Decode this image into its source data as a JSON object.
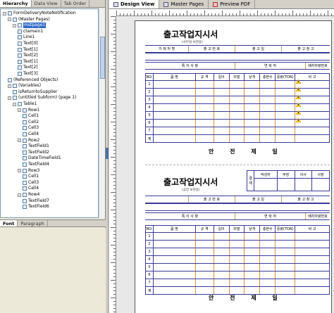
{
  "left_panel": {
    "tabs": [
      "Hierarchy",
      "Data View",
      "Tab Order"
    ],
    "tree": [
      {
        "label": "FormDeliveryNoteNotification",
        "indent": 0,
        "expander": "-"
      },
      {
        "label": "(Master Pages)",
        "indent": 1,
        "expander": "-"
      },
      {
        "label": "mstpage1",
        "indent": 2,
        "expander": "-",
        "selected": true
      },
      {
        "label": "ctamain1",
        "indent": 3
      },
      {
        "label": "Line1",
        "indent": 3
      },
      {
        "label": "Text[0]",
        "indent": 3
      },
      {
        "label": "Text[1]",
        "indent": 3
      },
      {
        "label": "Text[2]",
        "indent": 3
      },
      {
        "label": "Text[1]",
        "indent": 3
      },
      {
        "label": "Text[2]",
        "indent": 3
      },
      {
        "label": "Text[3]",
        "indent": 3
      },
      {
        "label": "(Referenced Objects)",
        "indent": 1
      },
      {
        "label": "(Variables)",
        "indent": 1,
        "expander": "-"
      },
      {
        "label": "isReturntoSupplier",
        "indent": 2
      },
      {
        "label": "(untitled Subform) (page 1)",
        "indent": 1,
        "expander": "-"
      },
      {
        "label": "Table1",
        "indent": 2,
        "expander": "-"
      },
      {
        "label": "Row1",
        "indent": 3,
        "expander": "-"
      },
      {
        "label": "Cell1",
        "indent": 4
      },
      {
        "label": "Cell2",
        "indent": 4
      },
      {
        "label": "Cell3",
        "indent": 4
      },
      {
        "label": "Cell4",
        "indent": 4
      },
      {
        "label": "Row2",
        "indent": 3,
        "expander": "-"
      },
      {
        "label": "TextField1",
        "indent": 4
      },
      {
        "label": "TextField2",
        "indent": 4
      },
      {
        "label": "DateTimeField1",
        "indent": 4
      },
      {
        "label": "TextField4",
        "indent": 4
      },
      {
        "label": "Row3",
        "indent": 3,
        "expander": "-"
      },
      {
        "label": "Cell1",
        "indent": 4
      },
      {
        "label": "Cell3",
        "indent": 4
      },
      {
        "label": "Cell4",
        "indent": 4
      },
      {
        "label": "Row4",
        "indent": 3,
        "expander": "-"
      },
      {
        "label": "TextField7",
        "indent": 4
      },
      {
        "label": "TextField6",
        "indent": 4
      }
    ],
    "bottom_tabs": [
      "Font",
      "Paragraph"
    ]
  },
  "design_tabs": [
    "Design View",
    "Master Pages",
    "Preview PDF"
  ],
  "form1": {
    "title": "출고작업지시서",
    "subtitle": "(사무실 보관용)",
    "header_row": [
      "거 래 처 명",
      "출 고 번 호",
      "출 고 일",
      "출 고 창 고"
    ],
    "row2": [
      "특 이 사 항",
      "연 락 처",
      "배차차량번호"
    ],
    "columns": [
      "NO.",
      "품 명",
      "규 격",
      "길이",
      "타발",
      "낱개",
      "총본수",
      "중량(TON)",
      "비 고"
    ],
    "rows": [
      "1",
      "2",
      "3",
      "4",
      "5",
      "6",
      "7",
      "계"
    ],
    "safety": "안 전 제 일"
  },
  "form2": {
    "title": "출고작업지시서",
    "subtitle": "(공장 보관용)",
    "approval_side": "결 재",
    "approval_cols": [
      "작성자",
      "부장",
      "이사",
      "사장"
    ],
    "header_row": [
      "출 고 번 호",
      "출 고 일",
      "출 고 창 고"
    ],
    "row2": [
      "특 이 사 항",
      "연 락 처",
      "배차차량번호"
    ],
    "columns": [
      "NO.",
      "품 명",
      "규 격",
      "길이",
      "타발",
      "낱개",
      "총본수",
      "중량(TON)",
      "비 고"
    ],
    "rows": [
      "1",
      "2",
      "3",
      "4",
      "5",
      "6",
      "7",
      "계"
    ],
    "safety": "안 전 제 일"
  }
}
